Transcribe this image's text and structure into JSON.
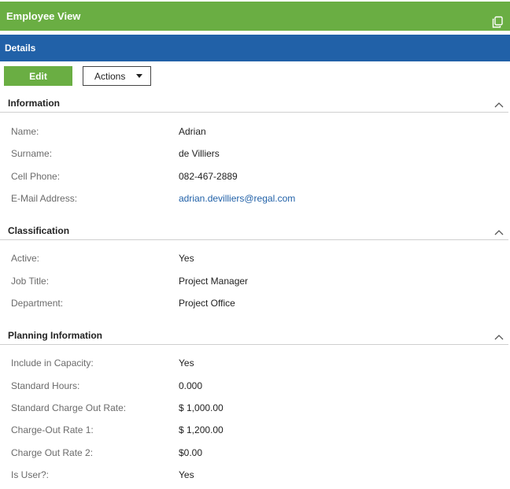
{
  "title": "Employee View",
  "details_label": "Details",
  "buttons": {
    "edit": "Edit",
    "actions": "Actions"
  },
  "sections": [
    {
      "title": "Information",
      "fields": [
        {
          "label": "Name:",
          "value": "Adrian"
        },
        {
          "label": "Surname:",
          "value": "de Villiers"
        },
        {
          "label": "Cell Phone:",
          "value": "082-467-2889"
        },
        {
          "label": "E-Mail Address:",
          "value": "adrian.devilliers@regal.com"
        }
      ]
    },
    {
      "title": "Classification",
      "fields": [
        {
          "label": "Active:",
          "value": "Yes"
        },
        {
          "label": "Job Title:",
          "value": "Project Manager"
        },
        {
          "label": "Department:",
          "value": "Project Office"
        }
      ]
    },
    {
      "title": "Planning Information",
      "fields": [
        {
          "label": "Include in Capacity:",
          "value": "Yes"
        },
        {
          "label": "Standard Hours:",
          "value": "0.000"
        },
        {
          "label": "Standard Charge Out Rate:",
          "value": "$ 1,000.00"
        },
        {
          "label": "Charge-Out Rate 1:",
          "value": "$ 1,200.00"
        },
        {
          "label": "Charge Out Rate 2:",
          "value": "$0.00"
        },
        {
          "label": "Is User?:",
          "value": "Yes"
        }
      ]
    }
  ],
  "colors": {
    "header_green": "#6aae43",
    "details_blue": "#2161a8",
    "link": "#2161a8"
  }
}
